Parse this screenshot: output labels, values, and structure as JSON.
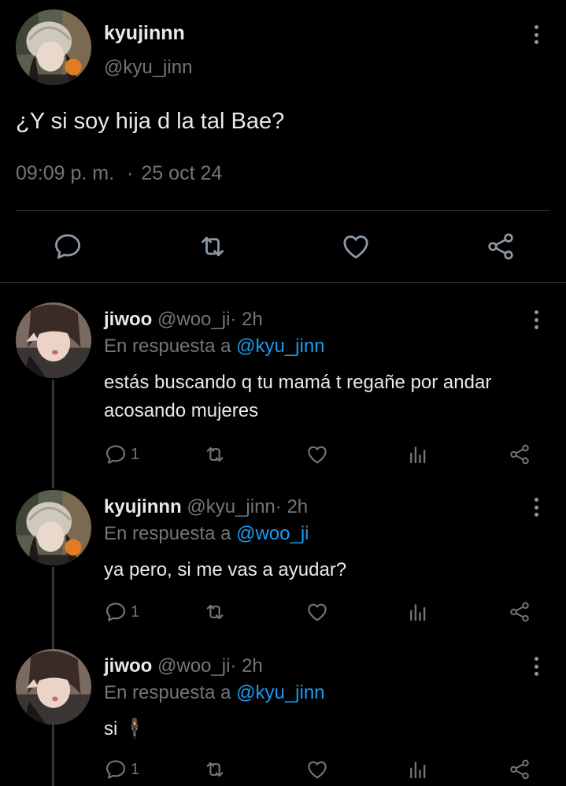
{
  "main_tweet": {
    "name": "kyujinnn",
    "handle": "@kyu_jinn",
    "text": "¿Y si soy hija d la tal Bae?",
    "time": "09:09 p. m.",
    "separator": "·",
    "date": "25 oct 24",
    "avatar_icon": "profile-photo-kyujinnn",
    "actions": [
      "reply-icon",
      "retweet-icon",
      "like-icon",
      "share-icon"
    ]
  },
  "replies": [
    {
      "name": "jiwoo",
      "handle": "@woo_ji",
      "separator": "·",
      "time": "2h",
      "reply_prefix": "En respuesta a",
      "reply_to": "@kyu_jinn",
      "text": "estás buscando q tu mamá t regañe por andar acosando mujeres",
      "reply_count": "1",
      "avatar_icon": "profile-photo-jiwoo"
    },
    {
      "name": "kyujinnn",
      "handle": "@kyu_jinn",
      "separator": "·",
      "time": "2h",
      "reply_prefix": "En respuesta a",
      "reply_to": "@woo_ji",
      "text": "ya pero, si me vas a ayudar?",
      "reply_count": "1",
      "avatar_icon": "profile-photo-kyujinnn"
    },
    {
      "name": "jiwoo",
      "handle": "@woo_ji",
      "separator": "·",
      "time": "2h",
      "reply_prefix": "En respuesta a",
      "reply_to": "@kyu_jinn",
      "text": "si 🕴",
      "reply_count": "1",
      "avatar_icon": "profile-photo-jiwoo"
    }
  ],
  "colors": {
    "background": "#000000",
    "text_primary": "#e7e9ea",
    "text_secondary": "#71767b",
    "accent": "#1d9bf0",
    "divider": "#2f3336"
  }
}
